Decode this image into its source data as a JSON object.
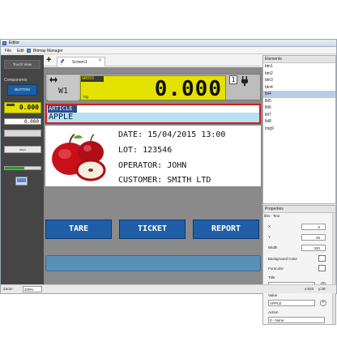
{
  "window": {
    "title": "Editor"
  },
  "menu": {
    "file": "File",
    "edit": "Edit",
    "bitmap_manager": "Bitmap Manager"
  },
  "palette": {
    "touch_view": "Touch View",
    "components_label": "Components",
    "button_label": "BUTTON",
    "weight_sample": "0.000",
    "number_sample": "0.000",
    "small_box_text": "abcd",
    "progress_fraction": 0.55
  },
  "tab": {
    "name": "Screen1",
    "close": "×",
    "add": "+"
  },
  "screen": {
    "scale_id": "W1",
    "gross_label": "GROSS",
    "weight": "0.000",
    "unit": "kg",
    "scale_number": "1",
    "article_title": "ARTICLE",
    "article_value": "APPLE",
    "date_line": "DATE: 15/04/2015 13:00",
    "lot_line": "LOT: 123546",
    "operator_line": "OPERATOR: JOHN",
    "customer_line": "CUSTOMER: SMITH LTD",
    "buttons": {
      "tare": "TARE",
      "ticket": "TICKET",
      "report": "REPORT"
    },
    "colors": {
      "weight_bg": "#e4e200",
      "button_bg": "#1f5ea6",
      "article_border": "#d02020"
    }
  },
  "elements": {
    "title": "Elements",
    "items": [
      "btn1",
      "btn2",
      "btn3",
      "btn4",
      "lbl4",
      "lbl5",
      "lbl6",
      "lbl7",
      "lbl8",
      "img9"
    ],
    "selected_index": 4
  },
  "properties": {
    "title": "Properties",
    "subtitle": "lbl4 - Text",
    "x_label": "X",
    "x_value": "0",
    "y_label": "Y",
    "y_value": "45",
    "width_label": "Width",
    "width_value": "320",
    "background_color_label": "Background Color",
    "forecolor_label": "Forecolor",
    "title_label": "Title",
    "title_value": "ARTICLE",
    "value_label": "Value",
    "value_value": "APPLE",
    "action_label": "Action",
    "action_value": "0 - None"
  },
  "status": {
    "zoom_label": "Zoom",
    "zoom_value": "200%",
    "coords": "x:616",
    "coords2": "y:28"
  }
}
